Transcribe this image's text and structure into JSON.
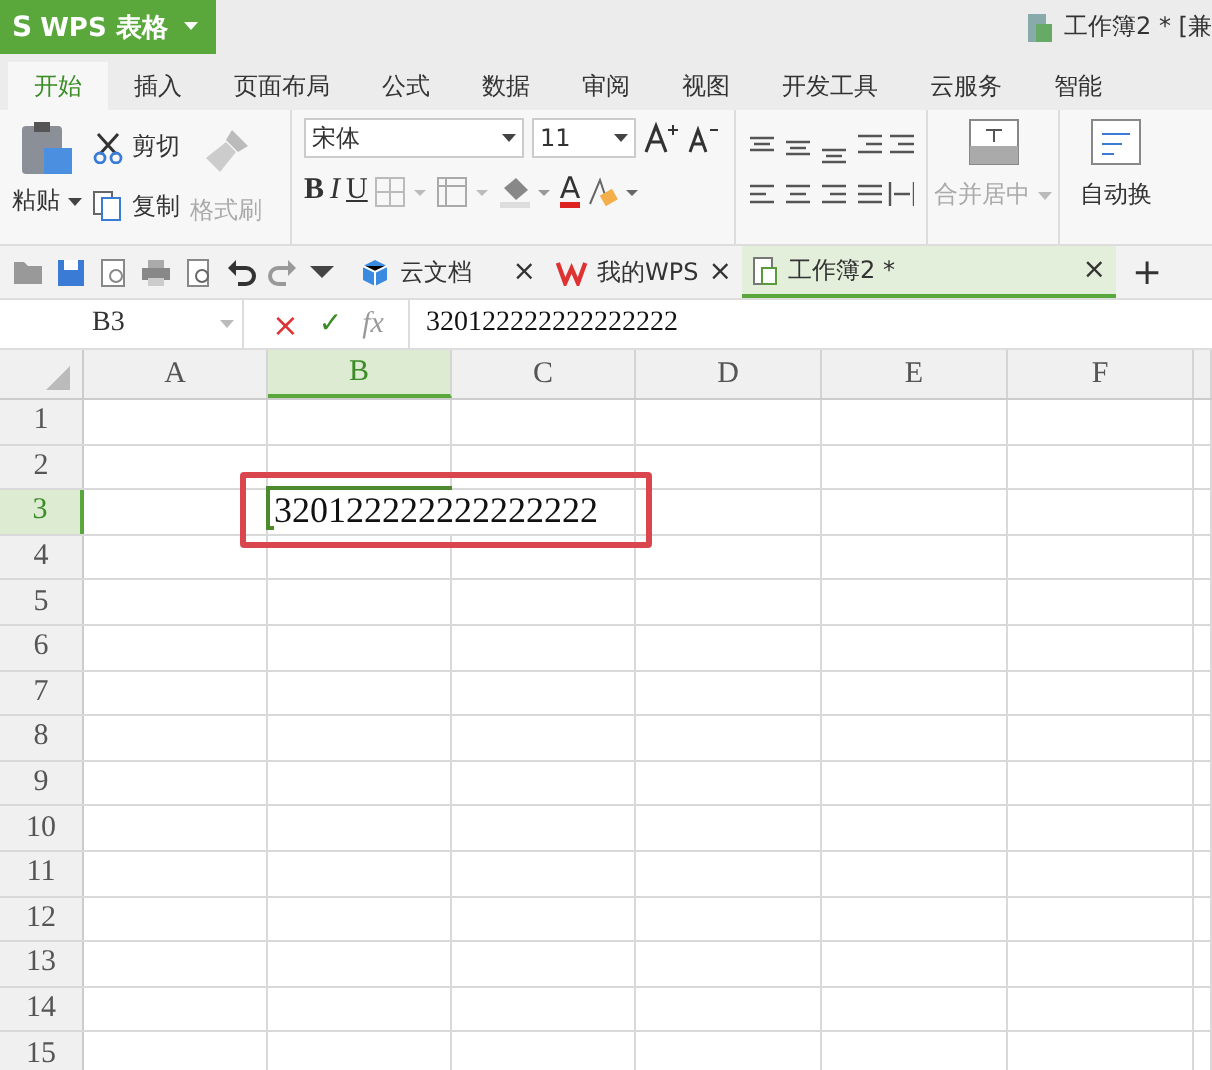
{
  "app": {
    "logo": "S",
    "name": "WPS 表格",
    "title": "工作簿2 * [兼"
  },
  "ribbon_tabs": [
    {
      "label": "开始",
      "selected": true
    },
    {
      "label": "插入",
      "selected": false
    },
    {
      "label": "页面布局",
      "selected": false
    },
    {
      "label": "公式",
      "selected": false
    },
    {
      "label": "数据",
      "selected": false
    },
    {
      "label": "审阅",
      "selected": false
    },
    {
      "label": "视图",
      "selected": false
    },
    {
      "label": "开发工具",
      "selected": false
    },
    {
      "label": "云服务",
      "selected": false
    },
    {
      "label": "智能",
      "selected": false
    }
  ],
  "clipboard": {
    "paste": "粘贴",
    "cut": "剪切",
    "copy": "复制",
    "format_painter": "格式刷",
    "format_painter_disabled": true
  },
  "font": {
    "name": "宋体",
    "size": "11",
    "bold": "B",
    "italic": "I",
    "underline": "U",
    "font_color": "A"
  },
  "merge": {
    "label": "合并居中",
    "disabled": true
  },
  "wrap": {
    "label": "自动换"
  },
  "doc_tabs": [
    {
      "kind": "cloud",
      "label": "云文档",
      "close": "×",
      "selected": false
    },
    {
      "kind": "wps",
      "label": "我的WPS",
      "close": "×",
      "selected": false
    },
    {
      "kind": "sheet",
      "label": "工作簿2 *",
      "close": "×",
      "selected": true
    }
  ],
  "new_tab": "+",
  "formula_bar": {
    "name_box": "B3",
    "cancel": "×",
    "confirm": "✓",
    "fx": "fx",
    "value": "320122222222222222"
  },
  "columns": [
    {
      "label": "A",
      "selected": false
    },
    {
      "label": "B",
      "selected": true
    },
    {
      "label": "C",
      "selected": false
    },
    {
      "label": "D",
      "selected": false
    },
    {
      "label": "E",
      "selected": false
    },
    {
      "label": "F",
      "selected": false
    }
  ],
  "rows": [
    {
      "label": "1",
      "selected": false
    },
    {
      "label": "2",
      "selected": false
    },
    {
      "label": "3",
      "selected": true,
      "value": "320122222222222222",
      "annotated": true
    },
    {
      "label": "4",
      "selected": false
    },
    {
      "label": "5",
      "selected": false
    },
    {
      "label": "6",
      "selected": false
    },
    {
      "label": "7",
      "selected": false
    },
    {
      "label": "8",
      "selected": false
    },
    {
      "label": "9",
      "selected": false
    },
    {
      "label": "10",
      "selected": false
    },
    {
      "label": "11",
      "selected": false
    },
    {
      "label": "12",
      "selected": false
    },
    {
      "label": "13",
      "selected": false
    },
    {
      "label": "14",
      "selected": false
    },
    {
      "label": "15",
      "selected": false
    }
  ]
}
